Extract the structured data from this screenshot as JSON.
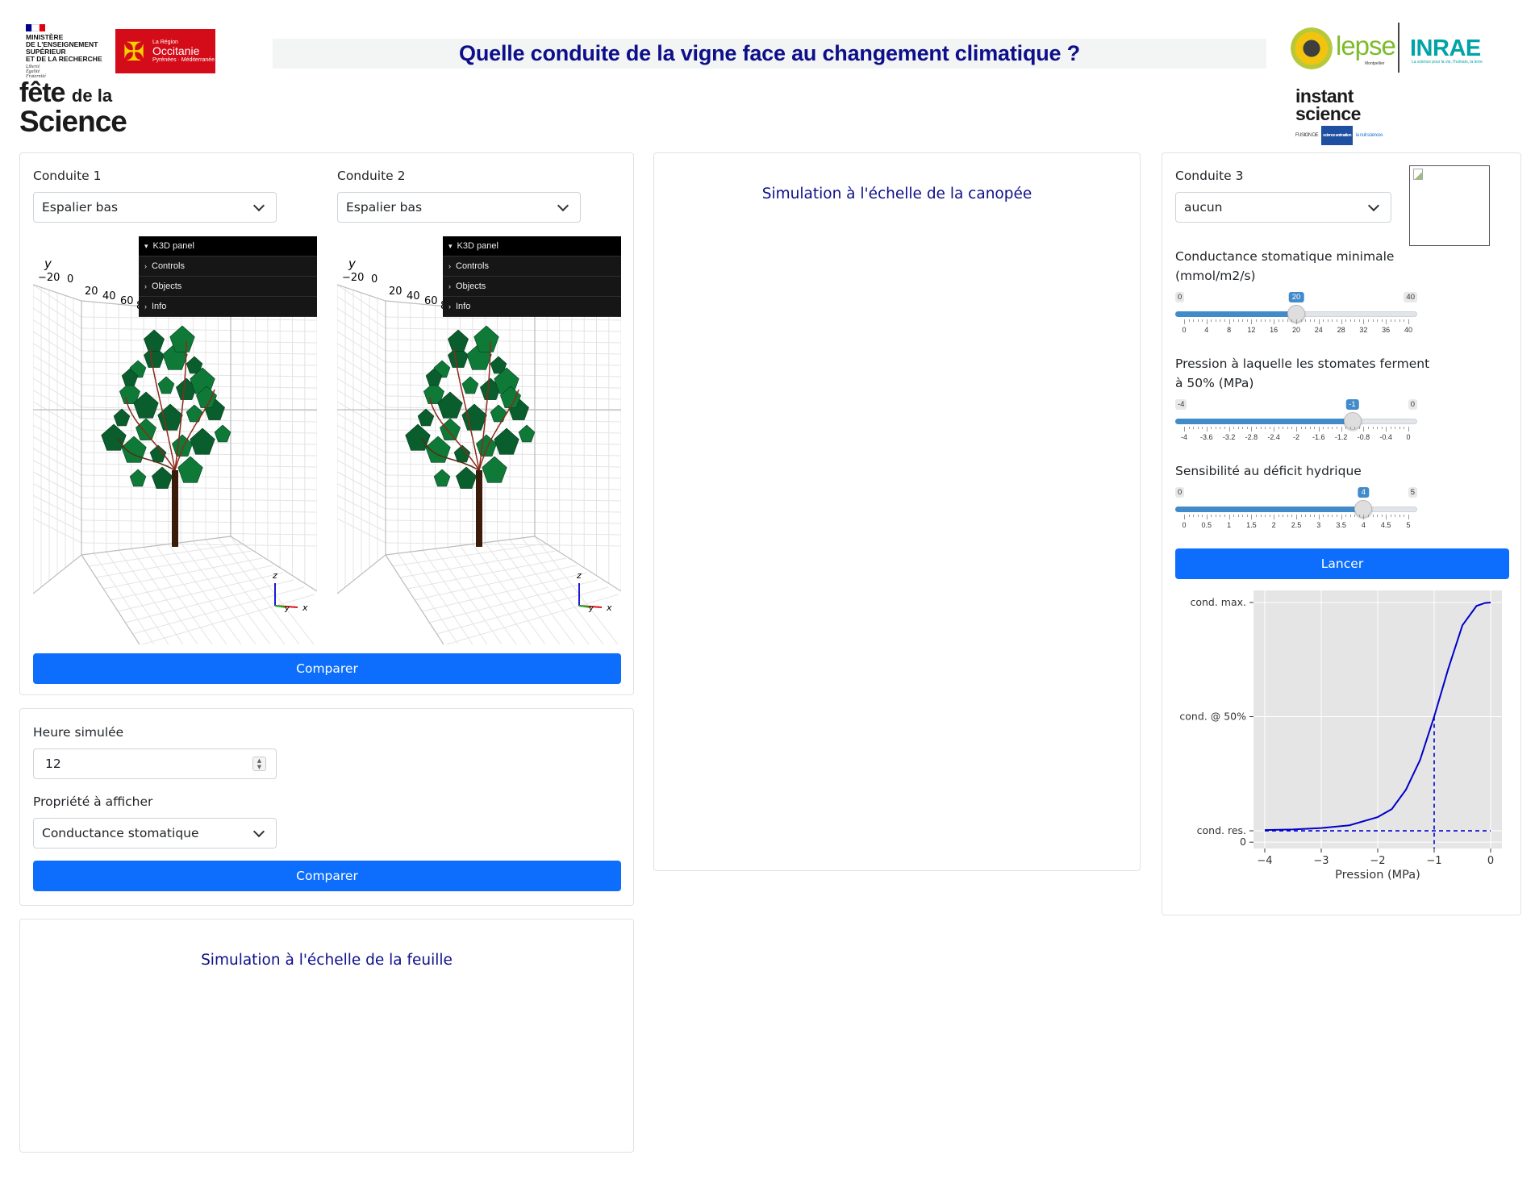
{
  "header": {
    "title": "Quelle conduite de la vigne face au changement climatique ?",
    "ministere": "MINISTÈRE\nDE L'ENSEIGNEMENT\nSUPÉRIEUR\nET DE LA RECHERCHE",
    "devise": "Liberté\nÉgalité\nFraternité",
    "region_small": "La Région",
    "region_name": "Occitanie",
    "region_sub": "Pyrénées · Méditerranée",
    "fete_line1": "fête",
    "fete_line1_small": "de la",
    "fete_line2": "Science",
    "lepse": "lepse",
    "lepse_sub": "Montpellier",
    "inrae": "INRAE",
    "inrae_sub": "La science pour la vie, l'humain, la terre",
    "instant_line1": "instant",
    "instant_line2": "science",
    "instant_sub": "FUSION DE",
    "instant_badge1": "science animation",
    "instant_badge2": "la nuit sciences"
  },
  "conduites": {
    "c1": {
      "label": "Conduite 1",
      "value": "Espalier bas"
    },
    "c2": {
      "label": "Conduite 2",
      "value": "Espalier bas"
    },
    "c3": {
      "label": "Conduite 3",
      "value": "aucun"
    }
  },
  "k3d": {
    "panel_title": "K3D panel",
    "items": [
      "Controls",
      "Objects",
      "Info"
    ],
    "axis_y": "y",
    "y_ticks": [
      "−20",
      "0",
      "20",
      "40",
      "60",
      "80"
    ],
    "axis_labels": {
      "x": "x",
      "y": "y",
      "z": "z"
    }
  },
  "buttons": {
    "compare1": "Comparer",
    "compare2": "Comparer",
    "launch": "Lancer"
  },
  "hour": {
    "label": "Heure simulée",
    "value": "12"
  },
  "property": {
    "label": "Propriété à afficher",
    "value": "Conductance stomatique"
  },
  "sections": {
    "canopy": "Simulation à l'échelle de la canopée",
    "leaf": "Simulation à l'échelle de la feuille"
  },
  "sliders": [
    {
      "label": "Conductance stomatique minimale (mmol/m2/s)",
      "min": "0",
      "max": "40",
      "value": "20",
      "fraction": 0.5,
      "ticks": [
        "0",
        "4",
        "8",
        "12",
        "16",
        "20",
        "24",
        "28",
        "32",
        "36",
        "40"
      ]
    },
    {
      "label": "Pression à laquelle les stomates ferment à 50% (MPa)",
      "min": "-4",
      "max": "0",
      "value": "-1",
      "fraction": 0.75,
      "ticks": [
        "-4",
        "-3.6",
        "-3.2",
        "-2.8",
        "-2.4",
        "-2",
        "-1.6",
        "-1.2",
        "-0.8",
        "-0.4",
        "0"
      ]
    },
    {
      "label": "Sensibilité au déficit hydrique",
      "min": "0",
      "max": "5",
      "value": "4",
      "fraction": 0.8,
      "ticks": [
        "0",
        "0.5",
        "1",
        "1.5",
        "2",
        "2.5",
        "3",
        "3.5",
        "4",
        "4.5",
        "5"
      ]
    }
  ],
  "colors": {
    "primary": "#0d6efd",
    "title": "#0d0f8a",
    "slider": "#428bca",
    "curve": "#0000cc",
    "plot_bg": "#e5e5e5"
  },
  "chart_data": {
    "type": "line",
    "xlabel": "Pression (MPa)",
    "ylabel": "",
    "xlim": [
      -4.2,
      0.2
    ],
    "x_ticks": [
      "−4",
      "−3",
      "−2",
      "−1",
      "0"
    ],
    "y_tick_labels": [
      "cond. max.",
      "cond. @ 50%",
      "cond. res.",
      "0"
    ],
    "y_tick_values": [
      1.0,
      0.5,
      0.0,
      -0.05
    ],
    "grid": true,
    "series": [
      {
        "x": [
          -4.0,
          -3.5,
          -3.0,
          -2.5,
          -2.0,
          -1.75,
          -1.5,
          -1.25,
          -1.0,
          -0.75,
          -0.5,
          -0.25,
          -0.1,
          0.0
        ],
        "y": [
          0.003,
          0.006,
          0.012,
          0.024,
          0.06,
          0.095,
          0.18,
          0.31,
          0.5,
          0.71,
          0.9,
          0.985,
          0.998,
          1.0
        ]
      }
    ],
    "annotations": {
      "p50": -1.0,
      "residual": 0.0
    }
  }
}
